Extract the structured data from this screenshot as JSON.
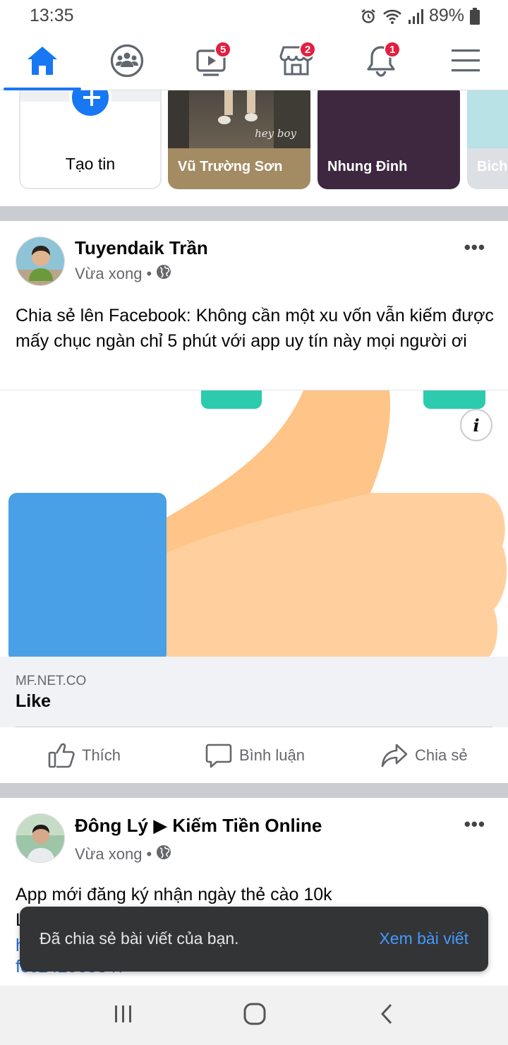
{
  "status_bar": {
    "time": "13:35",
    "battery": "89%",
    "icons": [
      "alarm-icon",
      "wifi-icon",
      "signal-icon",
      "battery-icon"
    ]
  },
  "nav": {
    "active_color": "#1877f2",
    "badge_color": "#e41e3f",
    "tabs": [
      {
        "icon": "home-icon",
        "badge": ""
      },
      {
        "icon": "groups-icon",
        "badge": ""
      },
      {
        "icon": "watch-icon",
        "badge": "5"
      },
      {
        "icon": "marketplace-icon",
        "badge": "2"
      },
      {
        "icon": "bell-icon",
        "badge": "1"
      },
      {
        "icon": "menu-icon",
        "badge": ""
      }
    ]
  },
  "stories": {
    "create_label": "Tạo tin",
    "items": [
      {
        "name": "Vũ Trường Sơn",
        "caption": "hey boy"
      },
      {
        "name": "Nhung Đinh"
      },
      {
        "name": "Bich"
      }
    ]
  },
  "post1": {
    "author": "Tuyendaik Trần",
    "time": "Vừa xong",
    "separator": "•",
    "text": "Chia sẻ lên Facebook: Không cần một xu vốn vẫn kiếm được mấy chục ngàn chỉ 5 phút với app uy tín này mọi người ơi",
    "link": {
      "domain": "MF.NET.CO",
      "title": "Like",
      "info_label": "i"
    }
  },
  "actions": {
    "like": "Thích",
    "comment": "Bình luận",
    "share": "Chia sẻ"
  },
  "post2": {
    "author": "Đông Lý ▶ Kiếm Tiền Online",
    "time": "Vừa xong",
    "separator": "•",
    "text": "App mới đăng ký nhận ngày thẻ cào 10k",
    "partial_line_2": "L",
    "partial_line_3": "h",
    "partial_line_4": "fcc242568347"
  },
  "toast": {
    "message": "Đã chia sẻ bài viết của bạn.",
    "action": "Xem bài viết"
  },
  "system_nav": {
    "buttons": [
      "recents-icon",
      "home-circle-icon",
      "back-icon"
    ]
  }
}
